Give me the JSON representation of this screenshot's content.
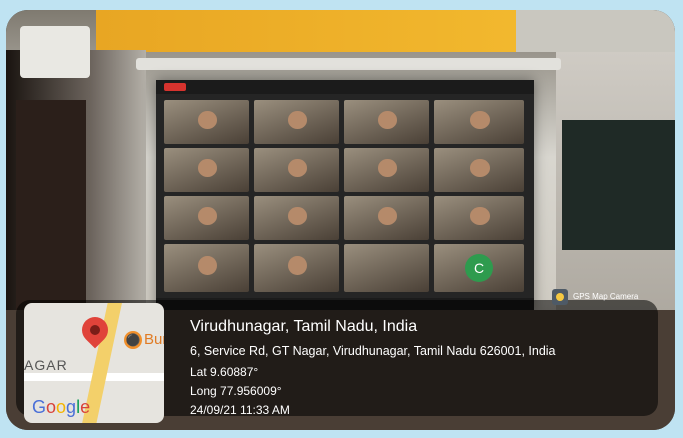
{
  "overlay": {
    "city_line": "Virudhunagar, Tamil Nadu, India",
    "address_line": "6, Service Rd, GT Nagar, Virudhunagar, Tamil Nadu 626001, India",
    "lat_line": "Lat 9.60887°",
    "long_line": "Long 77.956009°",
    "datetime_line": "24/09/21 11:33 AM",
    "app_badge": "GPS Map Camera"
  },
  "map": {
    "area_label_1": "AGAR",
    "area_label_2": "Burm",
    "poi_icon": "restaurant-icon",
    "brand_g": "G",
    "brand_o1": "o",
    "brand_o2": "o",
    "brand_g2": "g",
    "brand_l": "l",
    "brand_e": "e"
  },
  "meeting": {
    "avatar_letter": "C"
  },
  "colors": {
    "pin": "#e0433a",
    "google_blue": "#4a6fd8",
    "avatar_green": "#2e9b4e"
  }
}
